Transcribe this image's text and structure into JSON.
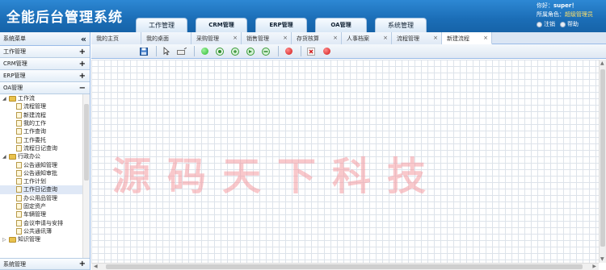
{
  "header": {
    "title": "全能后台管理系统",
    "nav_tabs": [
      "工作管理",
      "CRM管理",
      "ERP管理",
      "OA管理",
      "系统管理"
    ],
    "greeting_label": "你好：",
    "username": "super！",
    "role_label": "所属角色：",
    "role_value": "超级管理员",
    "logout_label": "注销",
    "help_label": "帮助"
  },
  "sidebar": {
    "title": "系统菜单",
    "collapse_symbol": "«",
    "groups": [
      {
        "label": "工作管理",
        "symbol": "+"
      },
      {
        "label": "CRM管理",
        "symbol": "+"
      },
      {
        "label": "ERP管理",
        "symbol": "+"
      },
      {
        "label": "OA管理",
        "symbol": "−"
      }
    ],
    "tree": {
      "folder1": "工作流",
      "folder1_items": [
        "流程管理",
        "新建流程",
        "我的工作",
        "工作查询",
        "工作委托",
        "流程日记查询"
      ],
      "folder2": "行政办公",
      "folder2_items": [
        "公告通知管理",
        "公告通知审批",
        "工作计划",
        "工作日记查询",
        "办公用品管理",
        "固定资产",
        "车辆管理",
        "会议申请与安排",
        "公共通讯薄"
      ],
      "folder3": "知识管理"
    },
    "bottom_group": {
      "label": "系统管理",
      "symbol": "+"
    }
  },
  "tabs": [
    {
      "label": "我的主页",
      "closable": false
    },
    {
      "label": "我的桌面",
      "closable": false
    },
    {
      "label": "采购管理",
      "closable": true
    },
    {
      "label": "销售管理",
      "closable": true
    },
    {
      "label": "存货核算",
      "closable": true
    },
    {
      "label": "人事档案",
      "closable": true
    },
    {
      "label": "流程管理",
      "closable": true
    },
    {
      "label": "新建流程",
      "closable": true
    }
  ],
  "close_symbol": "×",
  "watermark": "源码天下科技",
  "colors": {
    "header_bg": "#1b6db6",
    "toolbar_green": "#3cc63c",
    "toolbar_red": "#e02020",
    "watermark": "#f49ba0"
  },
  "toolbar_icons": [
    "save-icon",
    "pointer-icon",
    "line-icon",
    "start-node-icon",
    "task-node-icon",
    "auto-node-icon",
    "fork-node-icon",
    "join-node-icon",
    "end-node-icon",
    "delete-icon",
    "stop-icon"
  ]
}
